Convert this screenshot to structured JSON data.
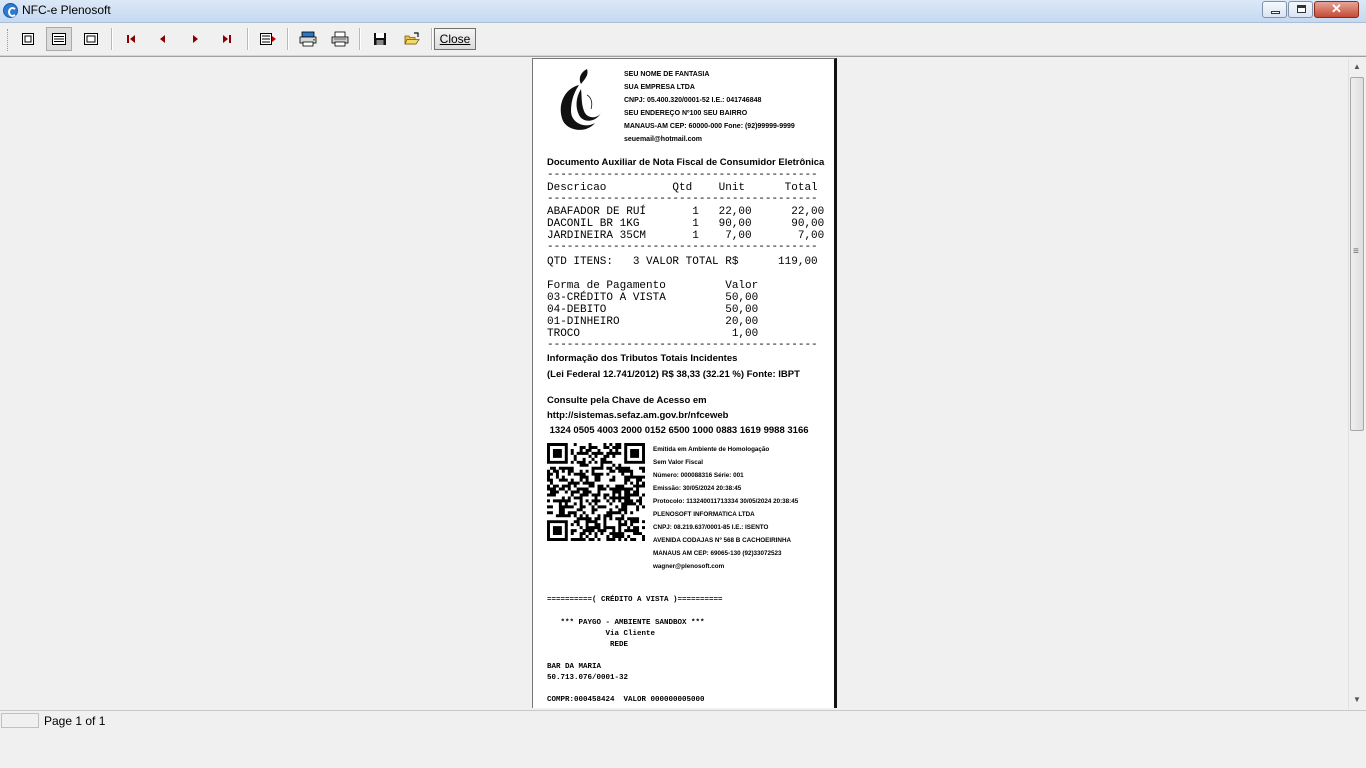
{
  "window": {
    "title": "NFC-e Plenosoft"
  },
  "toolbar": {
    "close_label": "Close",
    "buttons": [
      "whole-page-icon",
      "page-width-icon",
      "zoom-100-icon",
      "first-page-icon",
      "previous-page-icon",
      "next-page-icon",
      "last-page-icon",
      "go-to-page-icon",
      "printer-setup-icon",
      "print-icon",
      "save-icon",
      "open-icon"
    ]
  },
  "receipt": {
    "company": {
      "fantasy_name": "SEU NOME DE FANTASIA",
      "legal_name": "SUA EMPRESA LTDA",
      "cnpj": "CNPJ: 05.400.320/0001-52 I.E.: 041746848",
      "address": "SEU ENDEREÇO Nº100 SEU BAIRRO",
      "city": "MANAUS-AM CEP: 60000-000 Fone: (92)99999-9999",
      "email": "seuemail@hotmail.com"
    },
    "doc_title": "Documento Auxiliar de Nota Fiscal de Consumidor Eletrônica",
    "dashes": "-----------------------------------------",
    "items_header": "Descricao          Qtd    Unit      Total",
    "items": [
      "ABAFADOR DE RUÍ       1   22,00      22,00",
      "DACONIL BR 1KG        1   90,00      90,00",
      "JARDINEIRA 35CM       1    7,00       7,00"
    ],
    "total_line": "QTD ITENS:   3 VALOR TOTAL R$      119,00",
    "payment_header": "Forma de Pagamento         Valor",
    "payments": [
      "03-CRÉDITO A VISTA         50,00",
      "04-DEBITO                  50,00",
      "01-DINHEIRO                20,00",
      "TROCO                       1,00"
    ],
    "tributes_1": "Informação dos Tributos Totais Incidentes",
    "tributes_2": "(Lei Federal 12.741/2012) R$ 38,33 (32.21 %) Fonte: IBPT",
    "consult_1": "Consulte pela Chave de Acesso em",
    "consult_2": "http://sistemas.sefaz.am.gov.br/nfceweb",
    "access_key": " 1324 0505 4003 2000 0152 6500 1000 0883 1619 9988 3166",
    "homolog": [
      "Emitida em Ambiente de Homologação",
      "Sem Valor Fiscal",
      "Número: 000088316 Série: 001",
      "Emissão: 30/05/2024 20:38:45",
      "Protocolo: 113240011713334 30/05/2024 20:38:45",
      "PLENOSOFT INFORMATICA LTDA",
      "CNPJ: 08.219.637/0001-85 I.E.: ISENTO",
      "AVENIDA  CODAJAS  Nº  568  B  CACHOEIRINHA",
      "MANAUS  AM  CEP:  69065-130  (92)33072523",
      "wagner@plenosoft.com"
    ],
    "slip": {
      "heading": "==========( CRÉDITO A VISTA )==========",
      "sandbox": "   *** PAYGO - AMBIENTE SANDBOX ***",
      "via": "             Via Cliente",
      "network": "              REDE",
      "merchant": "BAR DA MARIA",
      "merchant_cnpj": "50.713.076/0001-32",
      "compr": "COMPR:000458424  VALOR 000000005000"
    }
  },
  "status": {
    "page": "Page 1 of 1"
  }
}
